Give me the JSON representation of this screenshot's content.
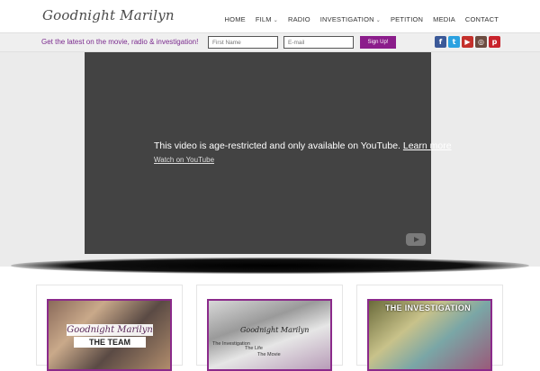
{
  "header": {
    "logo": "Goodnight Marilyn",
    "nav": [
      {
        "label": "HOME",
        "dropdown": false
      },
      {
        "label": "FILM",
        "dropdown": true
      },
      {
        "label": "RADIO",
        "dropdown": false
      },
      {
        "label": "INVESTIGATION",
        "dropdown": true
      },
      {
        "label": "PETITION",
        "dropdown": false
      },
      {
        "label": "MEDIA",
        "dropdown": false
      },
      {
        "label": "CONTACT",
        "dropdown": false
      }
    ]
  },
  "signup": {
    "text": "Get the latest on the movie, radio & investigation!",
    "first_name_placeholder": "First Name",
    "email_placeholder": "E-mail",
    "button_label": "Sign Up!",
    "social": [
      {
        "icon": "facebook-icon",
        "glyph": "f"
      },
      {
        "icon": "twitter-icon",
        "glyph": "t"
      },
      {
        "icon": "youtube-icon",
        "glyph": "▶"
      },
      {
        "icon": "instagram-icon",
        "glyph": "◎"
      },
      {
        "icon": "pinterest-icon",
        "glyph": "p"
      }
    ]
  },
  "video": {
    "message": "This video is age-restricted and only available on YouTube.",
    "learn_more": "Learn more",
    "watch_link": "Watch on YouTube"
  },
  "cards": [
    {
      "title_script": "Goodnight Marilyn",
      "subtitle": "THE TEAM"
    },
    {
      "logo": "Goodnight Marilyn",
      "line1": "The Investigation",
      "line2": "The Life",
      "line3": "The Movie"
    },
    {
      "title": "THE INVESTIGATION"
    }
  ],
  "colors": {
    "accent_purple": "#8b1d8b",
    "signup_text": "#7a2a8e",
    "video_bg": "#434343"
  }
}
